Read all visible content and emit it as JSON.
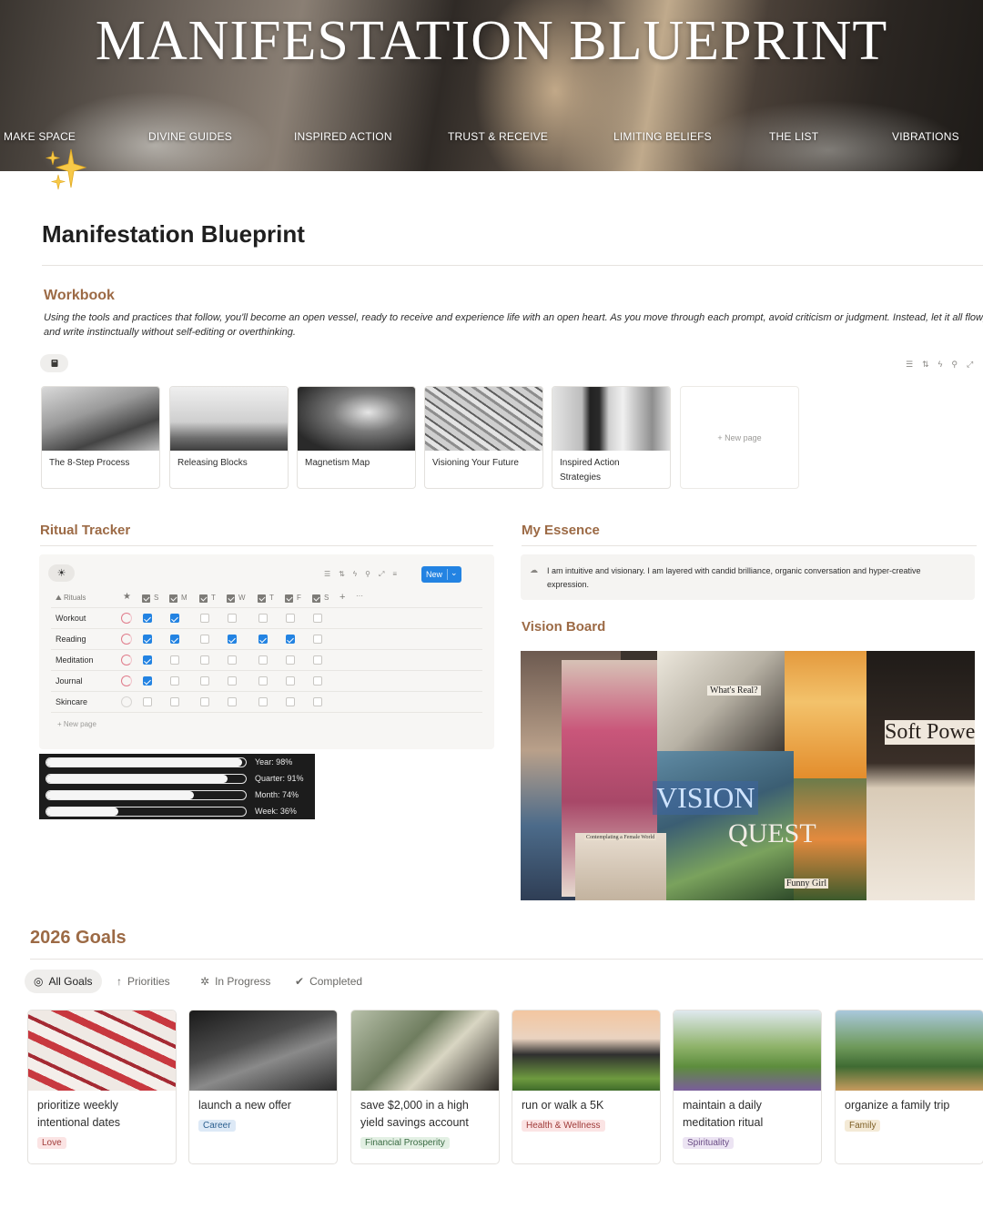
{
  "banner": {
    "title": "MANIFESTATION BLUEPRINT",
    "nav": [
      "MAKE SPACE",
      "DIVINE GUIDES",
      "INSPIRED ACTION",
      "TRUST & RECEIVE",
      "LIMITING BELIEFS",
      "THE LIST",
      "VIBRATIONS"
    ]
  },
  "page": {
    "title": "Manifestation Blueprint"
  },
  "workbook": {
    "title": "Workbook",
    "intro": "Using the tools and practices that follow, you'll become an open vessel, ready to receive and experience life with an open heart. As you move through each prompt, avoid criticism or judgment. Instead, let it all flow, and write instinctually without self-editing or overthinking.",
    "cards": [
      "The 8-Step Process",
      "Releasing Blocks",
      "Magnetism Map",
      "Visioning Your Future",
      "Inspired Action Strategies"
    ],
    "new_page": "+  New page"
  },
  "ritual_tracker": {
    "title": "Ritual Tracker",
    "new_button": "New",
    "rituals_header": "Rituals",
    "days": [
      "S",
      "M",
      "T",
      "W",
      "T",
      "F",
      "S"
    ],
    "rows": [
      {
        "name": "Workout",
        "checks": [
          true,
          true,
          false,
          false,
          false,
          false,
          false
        ]
      },
      {
        "name": "Reading",
        "checks": [
          true,
          true,
          false,
          true,
          true,
          true,
          false
        ]
      },
      {
        "name": "Meditation",
        "checks": [
          true,
          false,
          false,
          false,
          false,
          false,
          false
        ]
      },
      {
        "name": "Journal",
        "checks": [
          true,
          false,
          false,
          false,
          false,
          false,
          false
        ]
      },
      {
        "name": "Skincare",
        "checks": [
          false,
          false,
          false,
          false,
          false,
          false,
          false
        ]
      }
    ],
    "new_page": "+  New page"
  },
  "progress": [
    {
      "label": "Year: 98%",
      "value": 0.98
    },
    {
      "label": "Quarter: 91%",
      "value": 0.91
    },
    {
      "label": "Month: 74%",
      "value": 0.74
    },
    {
      "label": "Week: 36%",
      "value": 0.36
    }
  ],
  "essence": {
    "title": "My Essence",
    "text": "I am intuitive and visionary. I am layered with candid brilliance, organic conversation and hyper-creative expression."
  },
  "vision_board": {
    "title": "Vision Board",
    "words": [
      "What's Real?",
      "Soft Power",
      "VISION",
      "QUEST",
      "Funny Girl",
      "Contemplating a Female World"
    ]
  },
  "goals": {
    "title": "2026 Goals",
    "tabs": [
      "All Goals",
      "Priorities",
      "In Progress",
      "Completed"
    ],
    "cards": [
      {
        "title": "prioritize weekly intentional dates",
        "tag": "Love",
        "tag_bg": "#fbe4e4",
        "tag_fg": "#9f3a38"
      },
      {
        "title": "launch a new offer",
        "tag": "Career",
        "tag_bg": "#dde9f6",
        "tag_fg": "#2b5f8f"
      },
      {
        "title": "save $2,000 in a high yield savings account",
        "tag": "Financial Prosperity",
        "tag_bg": "#e3f0e4",
        "tag_fg": "#3a6b43"
      },
      {
        "title": "run or walk a 5K",
        "tag": "Health & Wellness",
        "tag_bg": "#fbe4e4",
        "tag_fg": "#9f3a38"
      },
      {
        "title": "maintain a daily meditation ritual",
        "tag": "Spirituality",
        "tag_bg": "#ece4f3",
        "tag_fg": "#6a4c85"
      },
      {
        "title": "organize a family trip",
        "tag": "Family",
        "tag_bg": "#f4ead6",
        "tag_fg": "#7d5f26"
      }
    ]
  }
}
